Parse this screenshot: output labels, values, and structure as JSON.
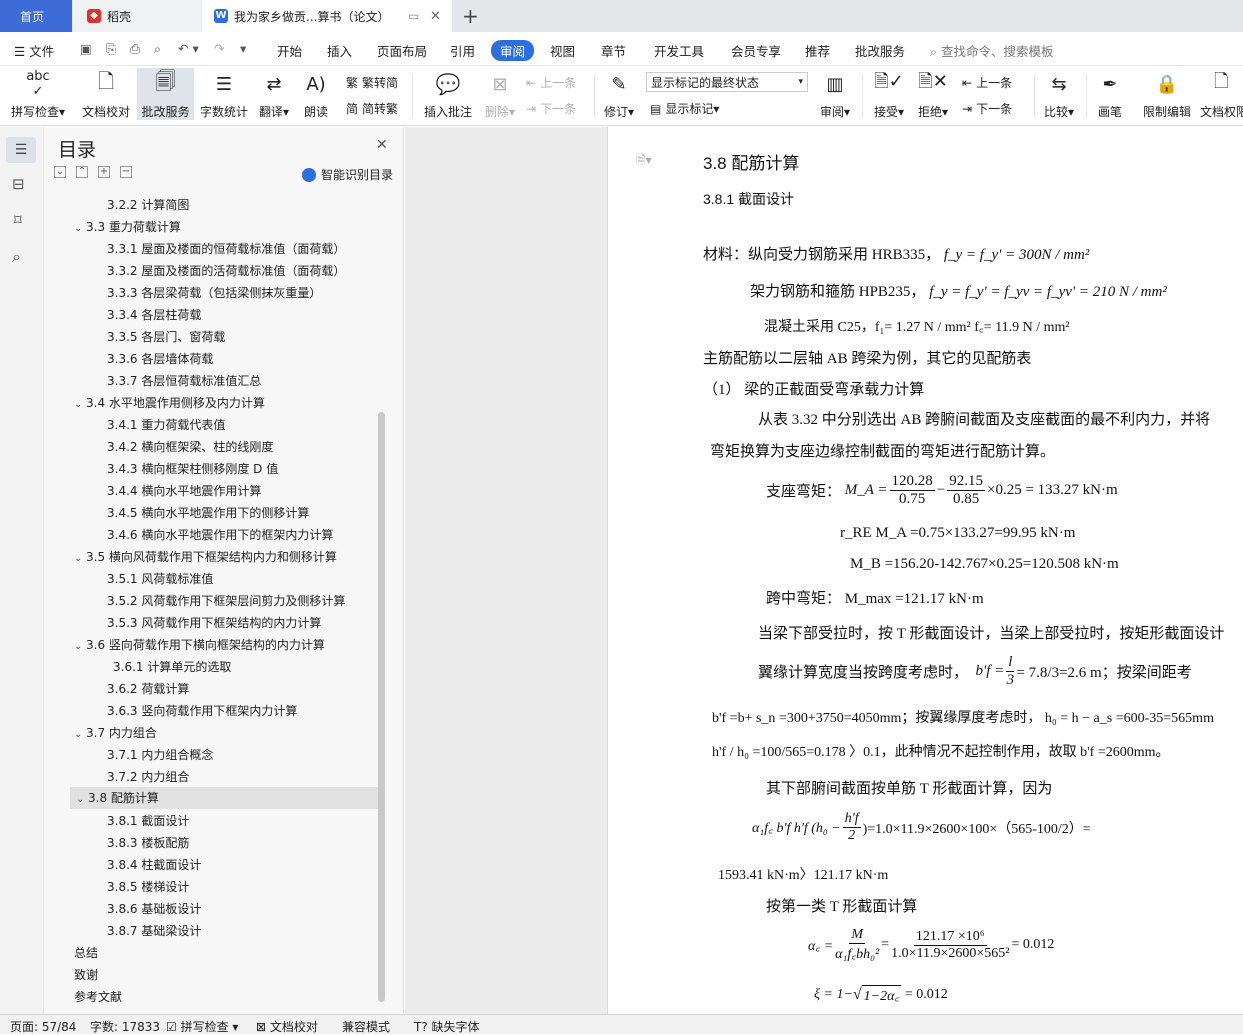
{
  "tabs": {
    "home": "首页",
    "daoke": "稻壳",
    "doc": "我为家乡做贡...算书（论文）"
  },
  "menu": {
    "file": "文件",
    "start": "开始",
    "insert": "插入",
    "layout": "页面布局",
    "ref": "引用",
    "review": "审阅",
    "view": "视图",
    "chapter": "章节",
    "dev": "开发工具",
    "member": "会员专享",
    "recommend": "推荐",
    "correction": "批改服务",
    "search": "查找命令、搜索模板"
  },
  "ribbon": {
    "spell": "拼写检查",
    "proof": "文档校对",
    "correct": "批改服务",
    "wordcount": "字数统计",
    "translate": "翻译",
    "read": "朗读",
    "t2s": "繁转简",
    "s2t": "简转繁",
    "add_comment": "插入批注",
    "delete": "删除",
    "prev": "上一条",
    "next": "下一条",
    "track": "修订",
    "markup_state": "显示标记的最终状态",
    "show_markup": "显示标记",
    "review_pane": "审阅",
    "accept": "接受",
    "reject": "拒绝",
    "prev2": "上一条",
    "next2": "下一条",
    "compare": "比较",
    "ink": "画笔",
    "restrict": "限制编辑",
    "perm": "文档权限"
  },
  "toc": {
    "title": "目录",
    "smart": "智能识别目录",
    "items": [
      {
        "t": "3.2.2 计算简图",
        "lv": 2
      },
      {
        "t": "3.3 重力荷载计算",
        "lv": 1
      },
      {
        "t": "3.3.1 屋面及楼面的恒荷载标准值（面荷载）",
        "lv": 2
      },
      {
        "t": "3.3.2 屋面及楼面的活荷载标准值（面荷载）",
        "lv": 2
      },
      {
        "t": "3.3.3 各层梁荷载（包括梁侧抹灰重量）",
        "lv": 2
      },
      {
        "t": "3.3.4 各层柱荷载",
        "lv": 2
      },
      {
        "t": "3.3.5 各层门、窗荷载",
        "lv": 2
      },
      {
        "t": "3.3.6 各层墙体荷载",
        "lv": 2
      },
      {
        "t": "3.3.7 各层恒荷载标准值汇总",
        "lv": 2
      },
      {
        "t": "3.4 水平地震作用侧移及内力计算",
        "lv": 1
      },
      {
        "t": "3.4.1 重力荷载代表值",
        "lv": 2
      },
      {
        "t": "3.4.2 横向框架梁、柱的线刚度",
        "lv": 2
      },
      {
        "t": "3.4.3 横向框架柱侧移刚度 D 值",
        "lv": 2
      },
      {
        "t": "3.4.4 横向水平地震作用计算",
        "lv": 2
      },
      {
        "t": "3.4.5 横向水平地震作用下的侧移计算",
        "lv": 2
      },
      {
        "t": "3.4.6 横向水平地震作用下的框架内力计算",
        "lv": 2
      },
      {
        "t": "3.5  横向风荷载作用下框架结构内力和侧移计算",
        "lv": 1
      },
      {
        "t": "3.5.1  风荷载标准值",
        "lv": 2
      },
      {
        "t": "3.5.2  风荷载作用下框架层间剪力及侧移计算",
        "lv": 2
      },
      {
        "t": "3.5.3  风荷载作用下框架结构的内力计算",
        "lv": 2
      },
      {
        "t": "3.6  竖向荷载作用下横向框架结构的内力计算",
        "lv": 1
      },
      {
        "t": "3.6.1  计算单元的选取",
        "lv": 3
      },
      {
        "t": "3.6.2 荷载计算",
        "lv": 2
      },
      {
        "t": "3.6.3 竖向荷载作用下框架内力计算",
        "lv": 2
      },
      {
        "t": "3.7  内力组合",
        "lv": 1
      },
      {
        "t": "3.7.1  内力组合概念",
        "lv": 2
      },
      {
        "t": "3.7.2  内力组合",
        "lv": 2
      },
      {
        "t": "3.8  配筋计算",
        "lv": 1,
        "sel": true
      },
      {
        "t": "3.8.1  截面设计",
        "lv": 2
      },
      {
        "t": "3.8.3 楼板配筋",
        "lv": 2
      },
      {
        "t": "3.8.4 柱截面设计",
        "lv": 2
      },
      {
        "t": "3.8.5 楼梯设计",
        "lv": 2
      },
      {
        "t": "3.8.6 基础板设计",
        "lv": 2
      },
      {
        "t": "3.8.7 基础梁设计",
        "lv": 2
      },
      {
        "t": "总结",
        "lv": 0
      },
      {
        "t": "致谢",
        "lv": 0
      },
      {
        "t": "参考文献",
        "lv": 0
      }
    ]
  },
  "doc": {
    "h1": "3.8  配筋计算",
    "h2": "3.8.1  截面设计",
    "l1": "材料：纵向受力钢筋采用 HRB335，",
    "l1m": "f_y = f_y' = 300N / mm²",
    "l2": "架力钢筋和箍筋 HPB235，",
    "l2m": "f_y = f_y' = f_yv = f_yv' = 210 N / mm²",
    "l3": "混凝土采用 C25，f₁= 1.27 N / mm²   f꜀= 11.9 N / mm²",
    "l4": "主筋配筋以二层轴 AB 跨梁为例，其它的见配筋表",
    "l5": "（1）  梁的正截面受弯承载力计算",
    "l6": "从表 3.32 中分别选出 AB 跨腑间截面及支座截面的最不利内力，并将",
    "l7": "弯矩换算为支座边缘控制截面的弯矩进行配筋计算。",
    "l8a": "支座弯矩：",
    "l8b": "M_A =",
    "l8n1": "120.28",
    "l8d1": "0.75",
    "l8n2": "92.15",
    "l8d2": "0.85",
    "l8c": "×0.25 = 133.27  kN·m",
    "l9": "r_RE M_A =0.75×133.27=99.95 kN·m",
    "l10": "M_B =156.20-142.767×0.25=120.508 kN·m",
    "l11": "跨中弯矩：  M_max =121.17 kN·m",
    "l12": "当梁下部受拉时，按 T 形截面设计，当梁上部受拉时，按矩形截面设计",
    "l13a": "翼缘计算宽度当按跨度考虑时，",
    "l13b": "b'f =",
    "l13n": "l",
    "l13d": "3",
    "l13c": "= 7.8/3=2.6 m；按梁间距考",
    "l14": "b'f =b+ s_n =300+3750=4050mm；按翼缘厚度考虑时，  h₀ = h − a_s =600-35=565mm",
    "l15": "h'f / h₀ =100/565=0.178 〉0.1，此种情况不起控制作用，故取 b'f =2600mm。",
    "l16": "其下部腑间截面按单筋 T 形截面计算，因为",
    "l17a": "α₁f꜀  b'f h'f (h₀ −",
    "l17n": "h'f",
    "l17d": "2",
    "l17c": ")=1.0×11.9×2600×100×（565-100/2）=",
    "l18": "1593.41 kN·m〉121.17  kN·m",
    "l19": "按第一类 T 形截面计算",
    "l20a": "α꜀ =",
    "l20n1": "M",
    "l20d1": "α₁f꜀bh₀²",
    "l20n2": "121.17 ×10⁶",
    "l20d2": "1.0×11.9×2600×565²",
    "l20c": "= 0.012",
    "l21a": "ξ = 1−",
    "l21s": "1−2α꜀",
    "l21c": "= 0.012"
  },
  "status": {
    "page": "页面: 57/84",
    "words": "字数: 17833",
    "spell": "拼写检查",
    "proof": "文档校对",
    "compat": "兼容模式",
    "missing_font": "缺失字体"
  },
  "colors": {
    "accent": "#2c6fe0",
    "home_tab": "#3d6bd8"
  }
}
